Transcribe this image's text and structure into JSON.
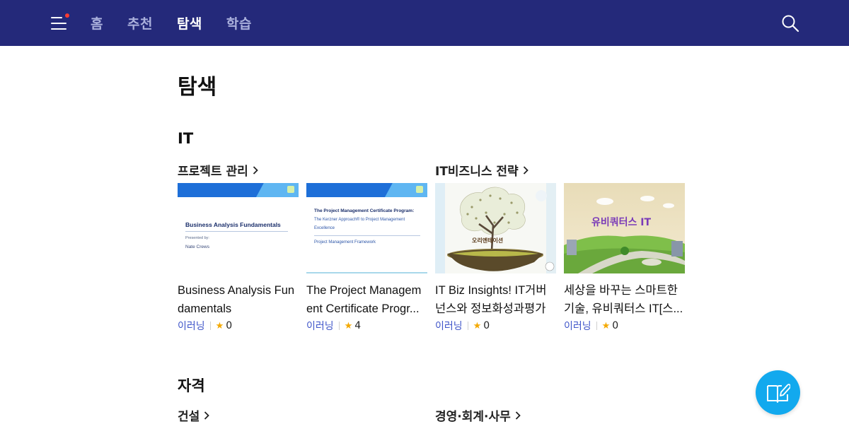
{
  "header": {
    "nav": [
      {
        "label": "홈"
      },
      {
        "label": "추천"
      },
      {
        "label": "탐색"
      },
      {
        "label": "학습"
      }
    ],
    "active_index": 2,
    "bg_color": "#24297a",
    "notification_dot_color": "#ff3b30"
  },
  "page": {
    "title": "탐색"
  },
  "sections": [
    {
      "title": "IT",
      "subcategories": [
        {
          "label": "프로젝트 관리"
        },
        {
          "label": "IT비즈니스 전략"
        }
      ],
      "cards": [
        {
          "title": "Business Analysis Fundamentals",
          "provider": "이러닝",
          "rating": "0",
          "thumb": {
            "lines": [
              "Business Analysis Fundamentals",
              "Presented by:",
              "Nate Crews"
            ]
          }
        },
        {
          "title": "The Project Management Certificate Progr...",
          "provider": "이러닝",
          "rating": "4",
          "thumb": {
            "lines": [
              "The Project Management Certificate Program:",
              "The Kerzner Approach® to Project Management",
              "Excellence",
              "Project Management Framework"
            ]
          }
        },
        {
          "title": "IT Biz Insights! IT거버넌스와 정보화성과평가",
          "provider": "이러닝",
          "rating": "0",
          "thumb": {
            "caption": "오리엔테이션"
          }
        },
        {
          "title": "세상을 바꾸는 스마트한 기술, 유비쿼터스 IT[스...",
          "provider": "이러닝",
          "rating": "0",
          "thumb": {
            "caption": "유비쿼터스 IT"
          }
        }
      ]
    },
    {
      "title": "자격",
      "subcategories": [
        {
          "label": "건설"
        },
        {
          "label": "경영·회계·사무"
        }
      ]
    }
  ],
  "fab": {
    "icon": "book-edit-icon",
    "color": "#12a9ee"
  },
  "colors": {
    "provider": "#3f55c9",
    "star": "#f4a900"
  }
}
